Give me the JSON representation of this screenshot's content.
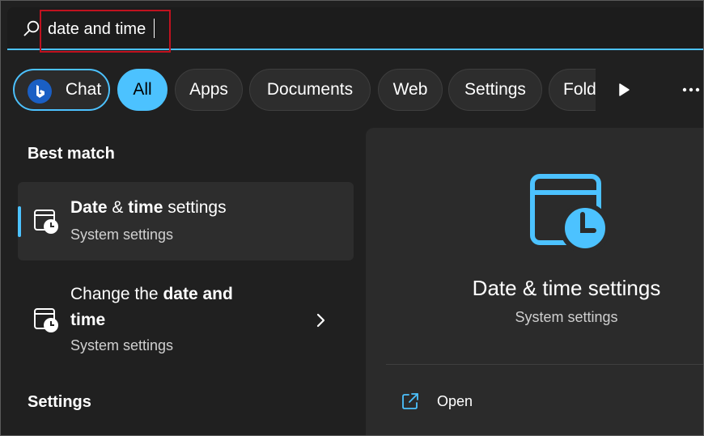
{
  "search": {
    "value": "date and time",
    "icon": "search-icon"
  },
  "filters": [
    {
      "label": "Chat",
      "icon": "bing-chat-icon"
    },
    {
      "label": "All",
      "active": true
    },
    {
      "label": "Apps"
    },
    {
      "label": "Documents"
    },
    {
      "label": "Web"
    },
    {
      "label": "Settings"
    },
    {
      "label": "Fold"
    }
  ],
  "sections": {
    "best_match": "Best match",
    "settings": "Settings"
  },
  "results": [
    {
      "title_bold": "Date",
      "title_mid": " & ",
      "title_bold2": "time",
      "title_rest": " settings",
      "subtitle": "System settings",
      "icon": "calendar-clock-icon"
    },
    {
      "title_line1_plain": "Change the ",
      "title_line1_bold": "date and",
      "title_line2_bold": "time",
      "subtitle": "System settings",
      "icon": "calendar-clock-icon"
    }
  ],
  "preview": {
    "title": "Date & time settings",
    "subtitle": "System settings",
    "icon": "calendar-clock-icon",
    "actions": [
      {
        "label": "Open",
        "icon": "open-external-icon"
      }
    ]
  },
  "colors": {
    "accent": "#4cc2ff",
    "background": "#202020",
    "panel": "#2b2b2b",
    "highlight_box": "#c0121f"
  }
}
